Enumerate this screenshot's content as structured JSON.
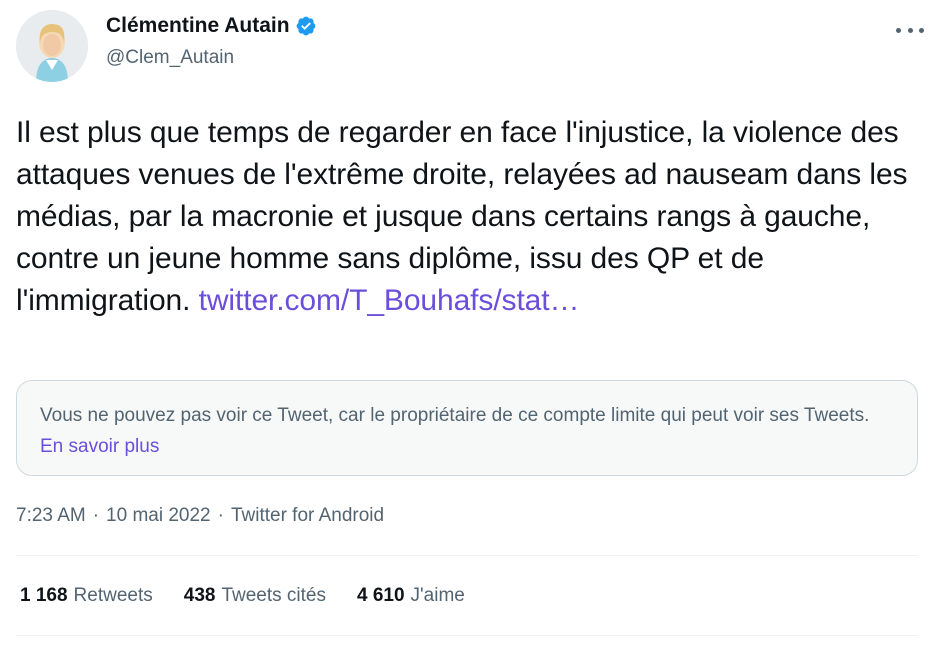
{
  "author": {
    "display_name": "Clémentine Autain",
    "handle": "@Clem_Autain"
  },
  "tweet": {
    "text": "Il est plus que temps de regarder en face l'injustice, la violence des attaques venues de l'extrême droite, relayées ad nauseam dans les médias, par la macronie et jusque dans certains rangs à gauche, contre un jeune homme sans diplôme, issu des QP et de l'immigration.",
    "link": "twitter.com/T_Bouhafs/stat…"
  },
  "notice": {
    "text": "Vous ne pouvez pas voir ce Tweet, car le propriétaire de ce compte limite qui peut voir ses Tweets.",
    "link": "En savoir plus"
  },
  "meta": {
    "time": "7:23 AM",
    "separator": "·",
    "date": "10 mai 2022",
    "source": "Twitter for Android"
  },
  "stats": {
    "retweets": {
      "count": "1 168",
      "label": "Retweets"
    },
    "quotes": {
      "count": "438",
      "label": "Tweets cités"
    },
    "likes": {
      "count": "4 610",
      "label": "J'aime"
    }
  },
  "colors": {
    "link": "#6b4ed9",
    "verified": "#1d9bf0",
    "secondary_text": "#536471"
  },
  "icons": {
    "verified": "verified-badge-icon",
    "more": "more-dots-icon"
  }
}
